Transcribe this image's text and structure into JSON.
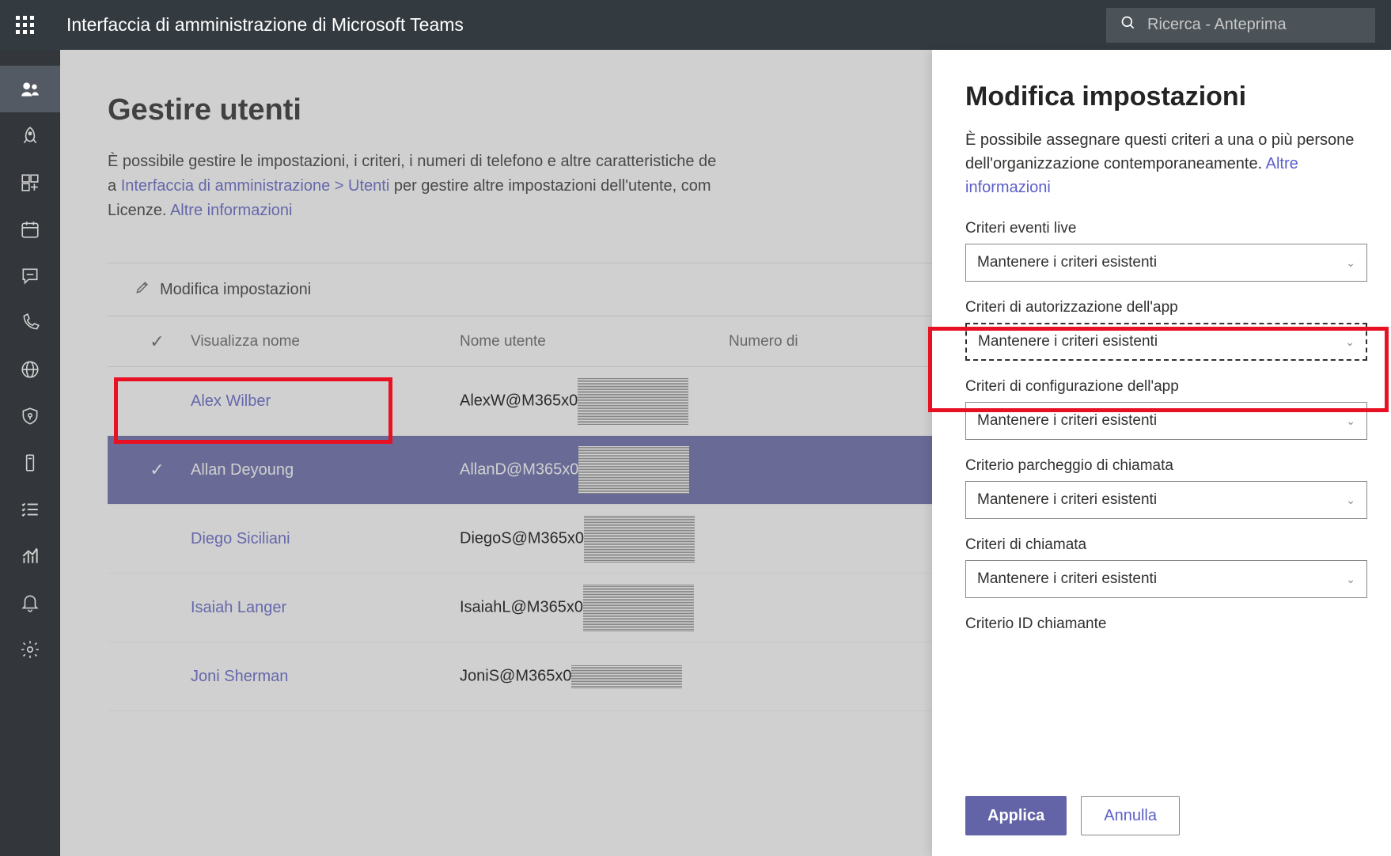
{
  "header": {
    "title": "Interfaccia di amministrazione di Microsoft Teams",
    "search_placeholder": "Ricerca - Anteprima"
  },
  "page": {
    "title": "Gestire utenti",
    "desc_prefix": "È possibile gestire le impostazioni, i criteri, i numeri di telefono e altre caratteristiche de",
    "desc_prefix2": "a ",
    "breadcrumb_link": "Interfaccia di amministrazione > Utenti",
    "desc_mid": " per gestire altre impostazioni dell'utente, com",
    "desc_prefix3": "Licenze. ",
    "more_info": "Altre informazioni"
  },
  "toolbar": {
    "edit_label": "Modifica impostazioni"
  },
  "table": {
    "headers": {
      "name": "Visualizza nome",
      "username": "Nome utente",
      "phone": "Numero di"
    },
    "rows": [
      {
        "name": "Alex Wilber",
        "username": "AlexW@M365x0",
        "selected": false
      },
      {
        "name": "Allan Deyoung",
        "username": "AllanD@M365x0",
        "selected": true
      },
      {
        "name": "Diego Siciliani",
        "username": "DiegoS@M365x0",
        "selected": false
      },
      {
        "name": "Isaiah Langer",
        "username": "IsaiahL@M365x0",
        "selected": false
      },
      {
        "name": "Joni Sherman",
        "username": "JoniS@M365x0",
        "selected": false
      }
    ]
  },
  "panel": {
    "title": "Modifica impostazioni",
    "desc": "È possibile assegnare questi criteri a una o più persone dell'organizzazione contemporaneamente. ",
    "more_info": "Altre informazioni",
    "fields": [
      {
        "label": "Criteri eventi live",
        "value": "Mantenere i criteri esistenti"
      },
      {
        "label": "Criteri di autorizzazione dell'app",
        "value": "Mantenere i criteri esistenti",
        "highlighted": true,
        "focused": true
      },
      {
        "label": "Criteri di configurazione dell'app",
        "value": "Mantenere i criteri esistenti"
      },
      {
        "label": "Criterio parcheggio di chiamata",
        "value": "Mantenere i criteri esistenti"
      },
      {
        "label": "Criteri di chiamata",
        "value": "Mantenere i criteri esistenti"
      },
      {
        "label": "Criterio ID chiamante",
        "value": ""
      }
    ],
    "apply": "Applica",
    "cancel": "Annulla"
  }
}
